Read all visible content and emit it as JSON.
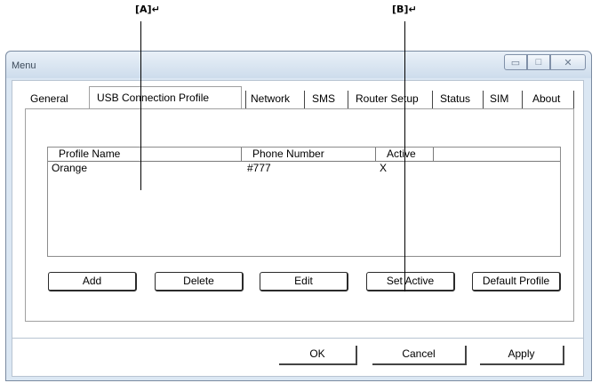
{
  "callouts": {
    "a_label": "[A]↵",
    "b_label": "[B]↵"
  },
  "window": {
    "title": "Menu",
    "minimize_glyph": "▭",
    "maximize_glyph": "□",
    "close_glyph": "✕"
  },
  "tabs": [
    {
      "label": "General"
    },
    {
      "label": "USB Connection Profile"
    },
    {
      "label": "Network"
    },
    {
      "label": "SMS"
    },
    {
      "label": "Router Setup"
    },
    {
      "label": "Status"
    },
    {
      "label": "SIM"
    },
    {
      "label": "About"
    }
  ],
  "profiles_table": {
    "columns": [
      "Profile Name",
      "Phone Number",
      "Active"
    ],
    "rows": [
      {
        "profile_name": "Orange",
        "phone_number": "#777",
        "active": "X"
      }
    ]
  },
  "profile_actions": {
    "add": "Add",
    "delete": "Delete",
    "edit": "Edit",
    "set_active": "Set Active",
    "default_profile": "Default Profile"
  },
  "dialog_buttons": {
    "ok": "OK",
    "cancel": "Cancel",
    "apply": "Apply"
  },
  "colors": {
    "window_frame": "#dbe7f3",
    "content_background": "#ffffff"
  }
}
